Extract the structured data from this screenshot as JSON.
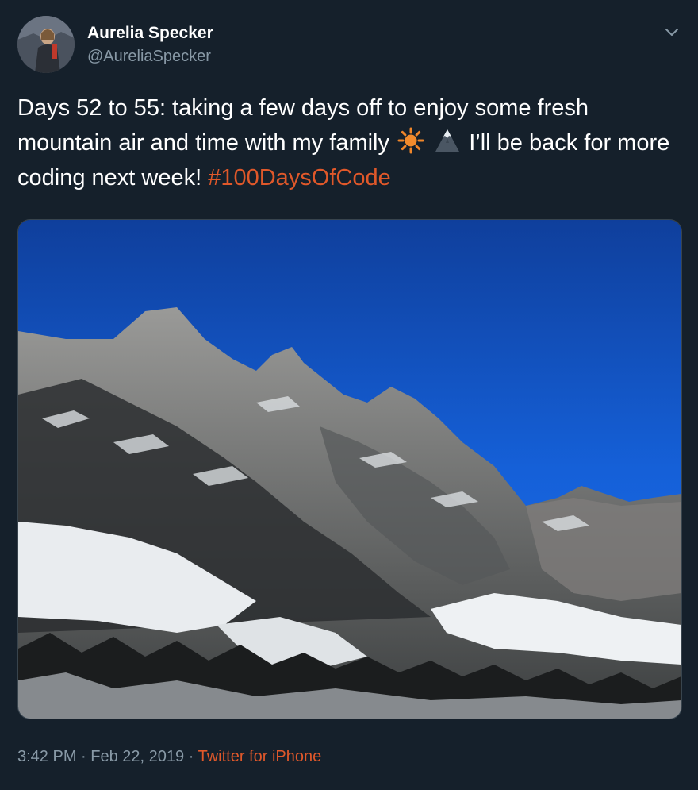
{
  "user": {
    "display_name": "Aurelia Specker",
    "handle": "@AureliaSpecker"
  },
  "tweet": {
    "text_part1": "Days 52 to 55: taking a few days off to enjoy some fresh mountain air and time with my family",
    "text_part2": "I’ll be back for more coding next week!",
    "hashtag": "#100DaysOfCode",
    "emoji": [
      "sun-icon",
      "mountain-icon"
    ]
  },
  "meta": {
    "time": "3:42 PM",
    "separator": "·",
    "date": "Feb 22, 2019",
    "source": "Twitter for iPhone"
  },
  "colors": {
    "background": "#15202b",
    "accent": "#e0582a",
    "secondary_text": "#8899a6",
    "primary_text": "#ffffff"
  }
}
